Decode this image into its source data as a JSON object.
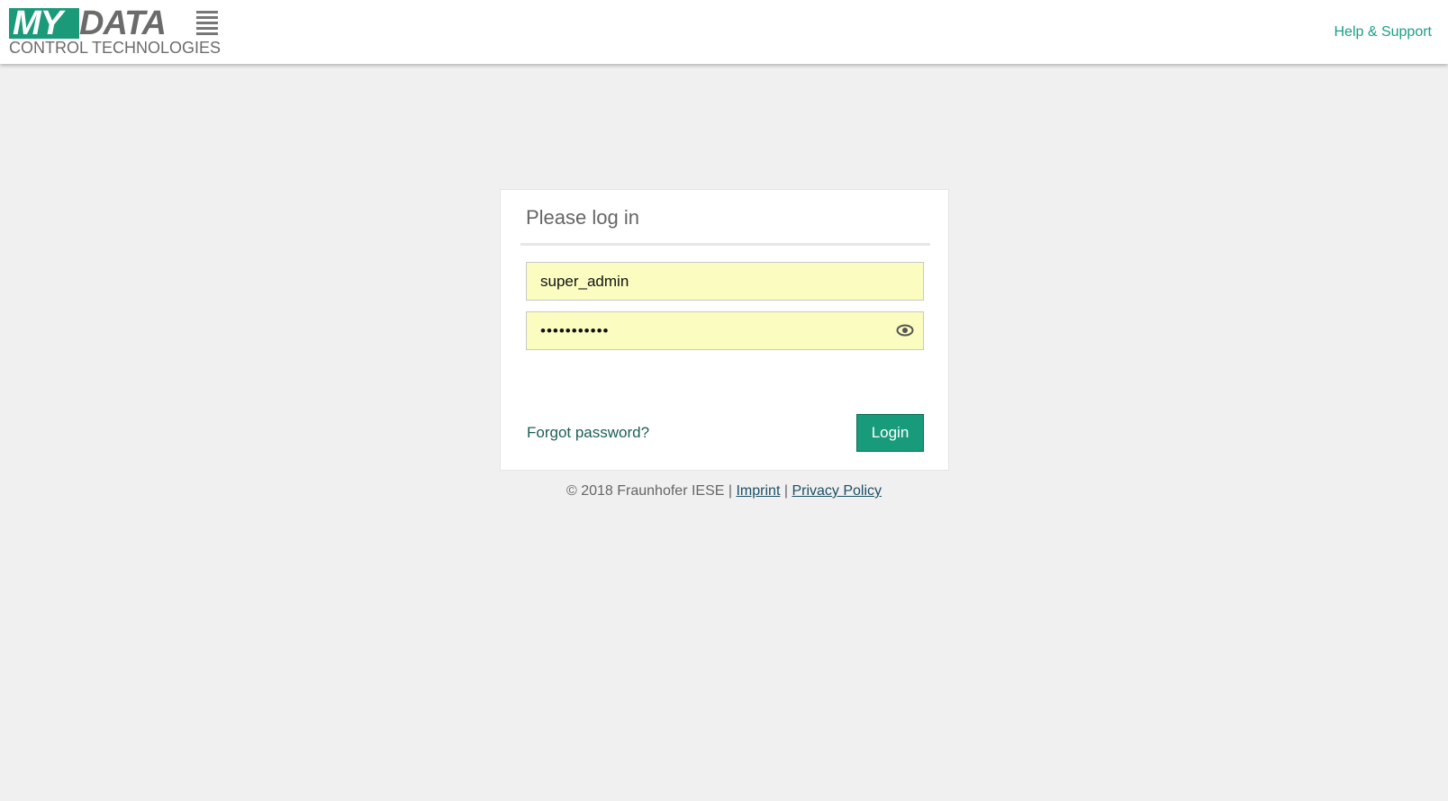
{
  "header": {
    "logo": {
      "brand_my": "MY",
      "brand_data": "DATA",
      "tagline": "CONTROL TECHNOLOGIES"
    },
    "help_link": "Help & Support"
  },
  "login": {
    "title": "Please log in",
    "username_value": "super_admin",
    "password_value": "•••••••••••",
    "forgot_link": "Forgot password?",
    "login_button": "Login"
  },
  "footer": {
    "copyright": "© 2018 Fraunhofer IESE",
    "sep1": " | ",
    "imprint": "Imprint",
    "sep2": " | ",
    "privacy": "Privacy Policy"
  },
  "colors": {
    "accent": "#189b7b",
    "input_bg": "#fafcc0",
    "background": "#f0f0f0"
  },
  "icons": {
    "password_toggle": "eye-icon"
  }
}
